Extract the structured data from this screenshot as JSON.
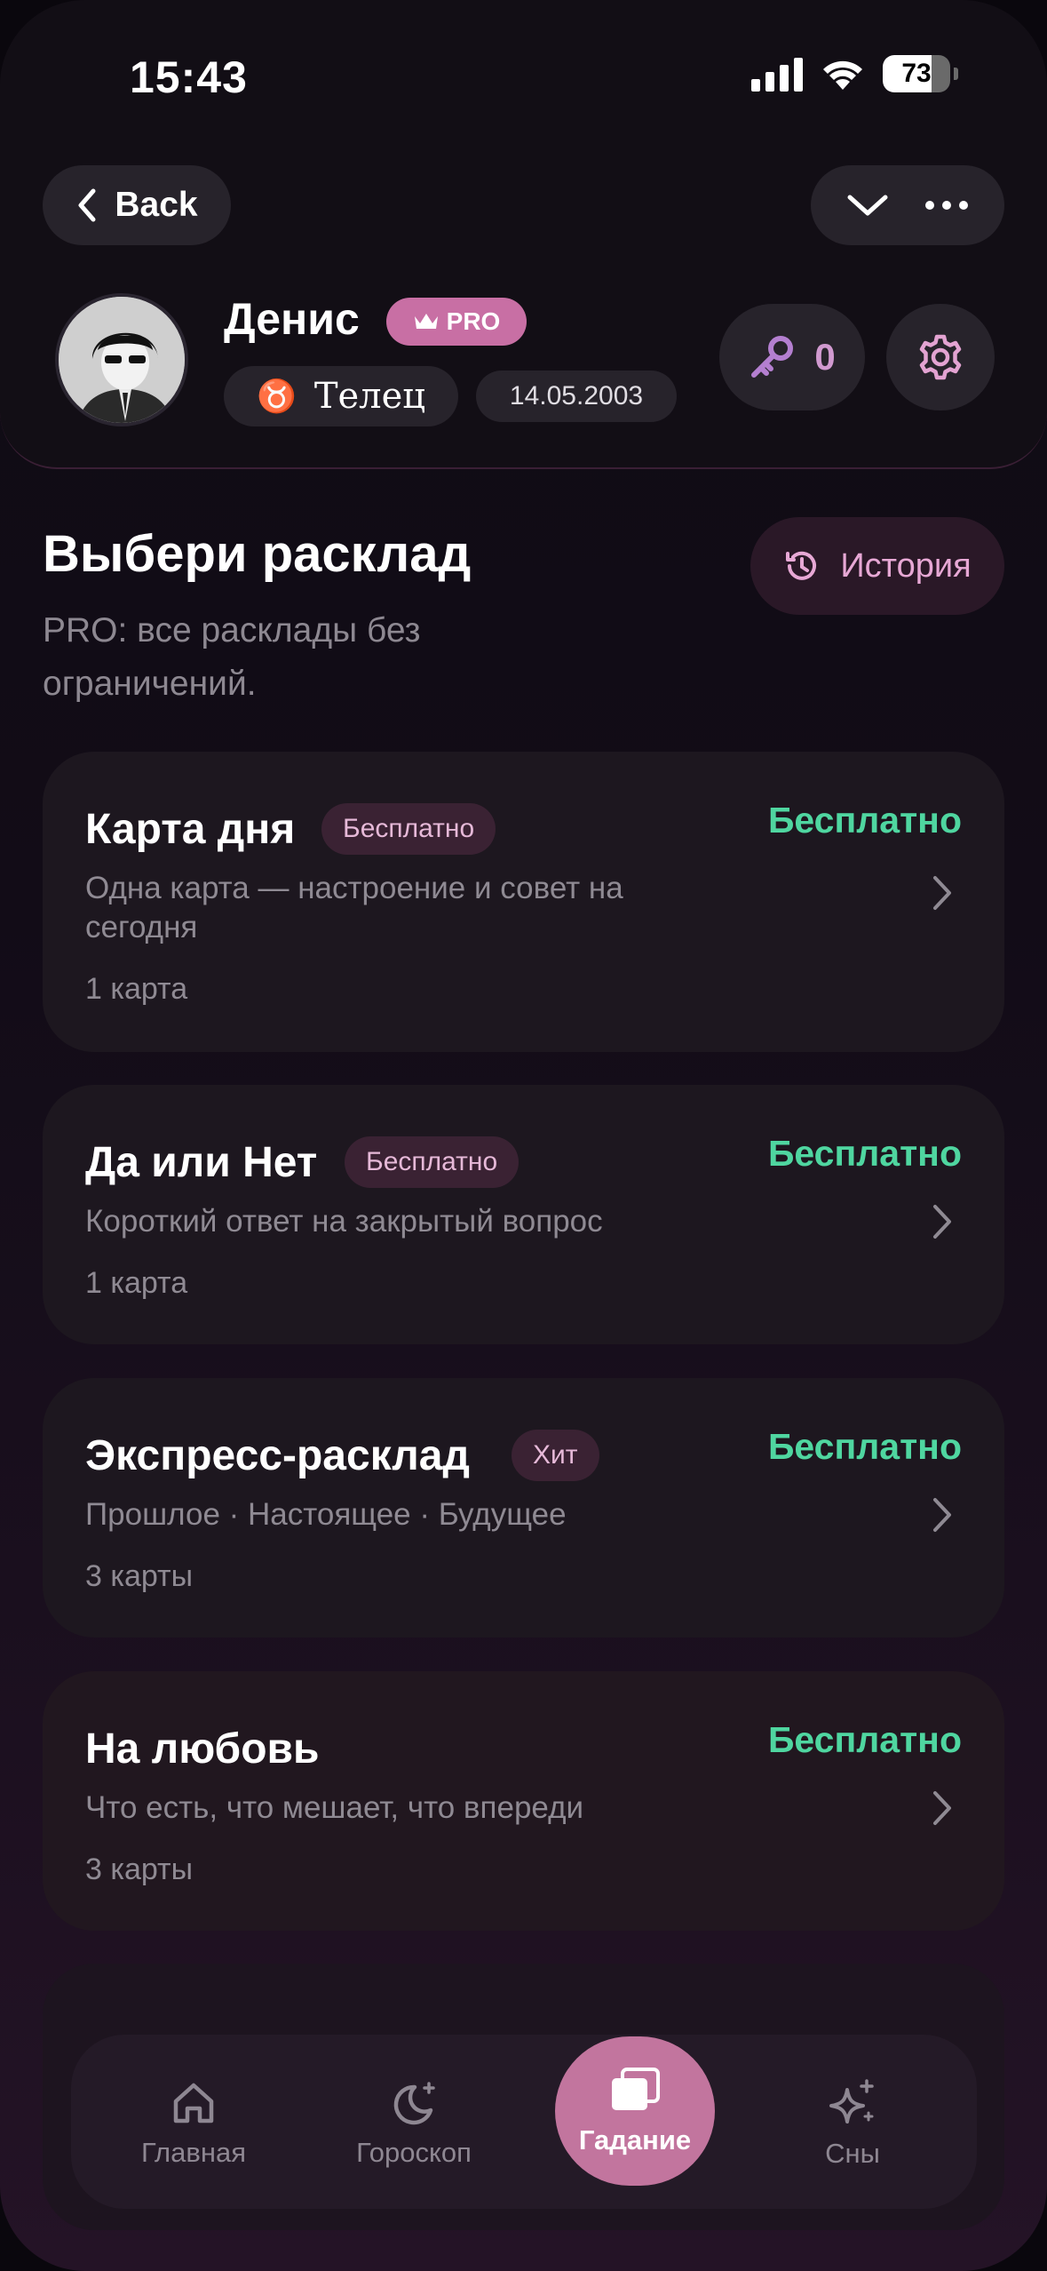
{
  "status_bar": {
    "time": "15:43",
    "battery": "73",
    "battery_level": 0.73
  },
  "header": {
    "back_label": "Back",
    "user_name": "Денис",
    "pro_label": "PRO",
    "sign_glyph": "♉",
    "sign_name": "Телец",
    "birth_date": "14.05.2003",
    "keys_count": "0",
    "icons": {
      "back": "chevron-left-icon",
      "collapse": "chevron-down-icon",
      "more": "more-icon",
      "key": "key-icon",
      "settings": "gear-icon",
      "crown": "crown-icon"
    }
  },
  "section": {
    "title": "Выбери расклад",
    "subtitle": "PRO: все расклады без ограничений.",
    "history_label": "История"
  },
  "cards": [
    {
      "title": "Карта дня",
      "tag": "Бесплатно",
      "price": "Бесплатно",
      "description": "Одна карта — настроение и совет на сегодня",
      "count": "1 карта"
    },
    {
      "title": "Да или Нет",
      "tag": "Бесплатно",
      "price": "Бесплатно",
      "description": "Короткий ответ на закрытый вопрос",
      "count": "1 карта"
    },
    {
      "title": "Экспресс-расклад",
      "tag": "Хит",
      "price": "Бесплатно",
      "description": "Прошлое · Настоящее · Будущее",
      "count": "3 карты"
    },
    {
      "title": "На любовь",
      "tag": "",
      "price": "Бесплатно",
      "description": "Что есть, что мешает, что впереди",
      "count": "3 карты"
    }
  ],
  "nav": {
    "items": [
      {
        "label": "Главная",
        "icon": "home-icon"
      },
      {
        "label": "Гороскоп",
        "icon": "moon-stars-icon"
      },
      {
        "label": "Гадание",
        "icon": "cards-icon",
        "active": true
      },
      {
        "label": "Сны",
        "icon": "sparkles-icon"
      }
    ]
  },
  "colors": {
    "accent": "#c86fa4",
    "price_green": "#4fd6a0",
    "card_bg": "#1d171f"
  }
}
